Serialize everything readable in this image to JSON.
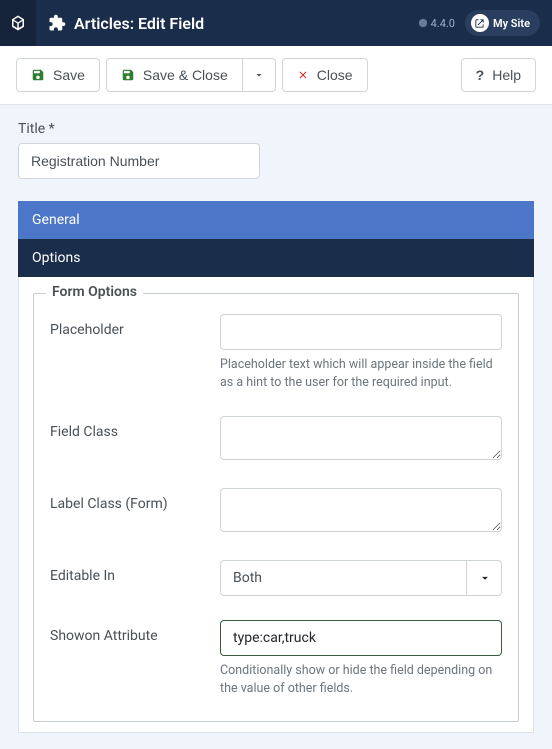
{
  "header": {
    "title": "Articles: Edit Field",
    "version": "4.4.0",
    "mysite_label": "My Site"
  },
  "toolbar": {
    "save": "Save",
    "save_close": "Save & Close",
    "close": "Close",
    "help": "Help"
  },
  "title_field": {
    "label": "Title *",
    "value": "Registration Number"
  },
  "tabs": {
    "general": "General",
    "options": "Options"
  },
  "form": {
    "legend": "Form Options",
    "placeholder": {
      "label": "Placeholder",
      "value": "",
      "help": "Placeholder text which will appear inside the field as a hint to the user for the required input."
    },
    "field_class": {
      "label": "Field Class",
      "value": ""
    },
    "label_class": {
      "label": "Label Class (Form)",
      "value": ""
    },
    "editable_in": {
      "label": "Editable In",
      "value": "Both"
    },
    "showon": {
      "label": "Showon Attribute",
      "value": "type:car,truck",
      "help": "Conditionally show or hide the field depending on the value of other fields."
    }
  }
}
